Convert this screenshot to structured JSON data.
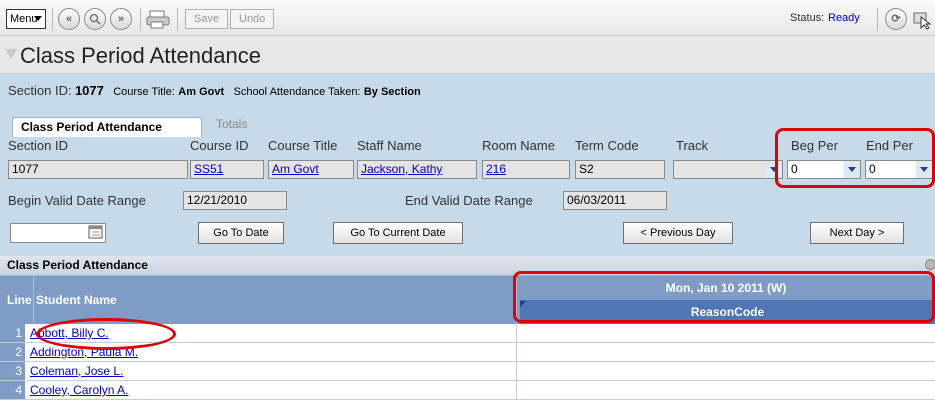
{
  "toolbar": {
    "menu_label": "Menu",
    "save_label": "Save",
    "undo_label": "Undo",
    "status_label": "Status:",
    "status_value": "Ready",
    "icons": [
      "first-icon",
      "search-icon",
      "last-icon",
      "print-icon",
      "refresh-icon",
      "help-icon"
    ]
  },
  "page": {
    "title": "Class Period Attendance"
  },
  "info": {
    "section_label": "Section ID:",
    "section_id": "1077",
    "course_title_label": "Course Title:",
    "course_title": "Am Govt",
    "school_attendance_label": "School Attendance Taken:",
    "school_attendance_value": "By Section"
  },
  "tabs": [
    {
      "label": "Class Period Attendance",
      "active": true
    },
    {
      "label": "Totals",
      "active": false
    }
  ],
  "form": {
    "labels": {
      "section_id": "Section ID",
      "course_id": "Course ID",
      "course_title": "Course Title",
      "staff_name": "Staff Name",
      "room_name": "Room Name",
      "term_code": "Term Code",
      "track": "Track",
      "beg_per": "Beg Per",
      "end_per": "End Per"
    },
    "values": {
      "section_id": "1077",
      "course_id": "SS51",
      "course_title": "Am Govt",
      "staff_name": "Jackson, Kathy",
      "room_name": "216",
      "term_code": "S2",
      "track": "",
      "beg_per": "0",
      "end_per": "0"
    },
    "begin_range_label": "Begin Valid Date Range",
    "begin_range_value": "12/21/2010",
    "end_range_label": "End Valid Date Range",
    "end_range_value": "06/03/2011",
    "date_input_value": ""
  },
  "buttons": {
    "go_to_date": "Go To Date",
    "go_to_current_date": "Go To Current Date",
    "previous_day": "< Previous Day",
    "next_day": "Next Day >"
  },
  "grid": {
    "title": "Class Period Attendance",
    "col_line": "Line",
    "col_student": "Student Name",
    "date_header": "Mon, Jan 10 2011 (W)",
    "reason_header": "ReasonCode",
    "rows": [
      {
        "line": "1",
        "name": "Abbott, Billy C."
      },
      {
        "line": "2",
        "name": "Addington, Paula M."
      },
      {
        "line": "3",
        "name": "Coleman, Jose L."
      },
      {
        "line": "4",
        "name": "Cooley, Carolyn A."
      }
    ]
  },
  "colors": {
    "highlight": "#e00000",
    "grid_header": "#7f9cc7",
    "info_bg": "#c6daea",
    "link": "#0000cc"
  }
}
